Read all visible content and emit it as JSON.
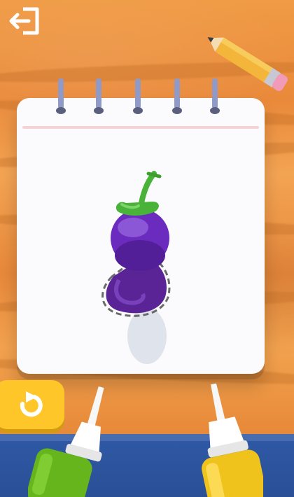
{
  "app": {
    "name": "",
    "scene": "",
    "background": {
      "wood_color": "#e98a36",
      "table_color": "#2f59a6"
    }
  },
  "icons": {
    "exit": "exit-icon",
    "undo": "undo-icon",
    "pencil": "pencil-icon",
    "eggplant": "eggplant-drawing"
  },
  "colors": {
    "eggplant_purple": "#6b2bbf",
    "eggplant_dark": "#3d1166",
    "stem_green": "#49b339",
    "undo_button": "#ffc629",
    "green_bottle": "#67b51c",
    "yellow_bottle": "#f0c21c"
  }
}
